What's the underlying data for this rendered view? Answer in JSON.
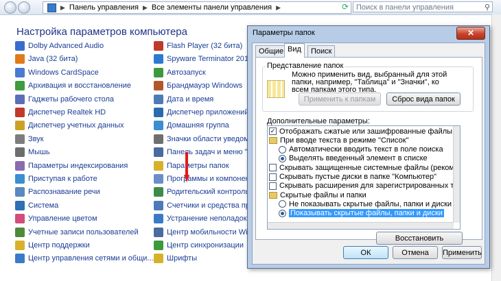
{
  "breadcrumbs": [
    "Панель управления",
    "Все элементы панели управления"
  ],
  "search_placeholder": "Поиск в панели управления",
  "page_title": "Настройка параметров компьютера",
  "left_items": [
    {
      "label": "Dolby Advanced Audio",
      "color": "#3b6ccd"
    },
    {
      "label": "Java (32 бита)",
      "color": "#e07b1a"
    },
    {
      "label": "Windows CardSpace",
      "color": "#4a7bd0"
    },
    {
      "label": "Архивация и восстановление",
      "color": "#3e9b3e"
    },
    {
      "label": "Гаджеты рабочего стола",
      "color": "#5b6fb8"
    },
    {
      "label": "Диспетчер Realtek HD",
      "color": "#c0392b"
    },
    {
      "label": "Диспетчер учетных данных",
      "color": "#c9a227"
    },
    {
      "label": "Звук",
      "color": "#7d7d7d"
    },
    {
      "label": "Мышь",
      "color": "#6d6d6d"
    },
    {
      "label": "Параметры индексирования",
      "color": "#8a6bb0"
    },
    {
      "label": "Приступая к работе",
      "color": "#3b8ed0"
    },
    {
      "label": "Распознавание речи",
      "color": "#5a88c0"
    },
    {
      "label": "Система",
      "color": "#2f6fb4"
    },
    {
      "label": "Управление цветом",
      "color": "#d24d7a"
    },
    {
      "label": "Учетные записи пользователей",
      "color": "#4f8a3c"
    },
    {
      "label": "Центр поддержки",
      "color": "#d8b12a"
    },
    {
      "label": "Центр управления сетями и общи...",
      "color": "#3a7bc8"
    }
  ],
  "right_items": [
    {
      "label": "Flash Player (32 бита)",
      "color": "#c0392b"
    },
    {
      "label": "Spyware Terminator 2015",
      "color": "#2d7bd1"
    },
    {
      "label": "Автозапуск",
      "color": "#3c9a3c"
    },
    {
      "label": "Брандмауэр Windows",
      "color": "#b3572a"
    },
    {
      "label": "Дата и время",
      "color": "#4f7ab8"
    },
    {
      "label": "Диспетчер приложений Int",
      "color": "#2a6bb0"
    },
    {
      "label": "Домашняя группа",
      "color": "#3b8ed0"
    },
    {
      "label": "Значки области уведомл",
      "color": "#6f6f6f"
    },
    {
      "label": "Панель задач и меню \"Пу",
      "color": "#4a6aa0"
    },
    {
      "label": "Параметры папок",
      "color": "#d8b12a"
    },
    {
      "label": "Программы и компоненты",
      "color": "#6a8fc8"
    },
    {
      "label": "Родительский контроль",
      "color": "#3e8a4a"
    },
    {
      "label": "Счетчики и средства про",
      "color": "#4f7ab8"
    },
    {
      "label": "Устранение неполадок",
      "color": "#3a7bc8"
    },
    {
      "label": "Центр мобильности Wind",
      "color": "#4a6aa0"
    },
    {
      "label": "Центр синхронизации",
      "color": "#3c9a3c"
    },
    {
      "label": "Шрифты",
      "color": "#d8b12a"
    }
  ],
  "dialog": {
    "title": "Параметры папок",
    "close_glyph": "✕",
    "tabs": [
      "Общие",
      "Вид",
      "Поиск"
    ],
    "active_tab": "Вид",
    "group_title": "Представление папок",
    "group_text": "Можно применить вид, выбранный для этой папки, например, \"Таблица\" и \"Значки\", ко всем папкам этого типа.",
    "apply_to_folders": "Применить к папкам",
    "reset_folders": "Сброс вида папок",
    "advanced_title": "Дополнительные параметры:",
    "advanced_items": [
      {
        "kind": "checkbox",
        "checked": true,
        "indent": 1,
        "label": "Отображать сжатые или зашифрованные файлы NTF"
      },
      {
        "kind": "folder",
        "indent": 1,
        "label": "При вводе текста в режиме \"Список\""
      },
      {
        "kind": "radio",
        "checked": false,
        "indent": 2,
        "label": "Автоматически вводить текст в поле поиска"
      },
      {
        "kind": "radio",
        "checked": true,
        "indent": 2,
        "label": "Выделять введенный элемент в списке"
      },
      {
        "kind": "checkbox",
        "checked": false,
        "indent": 1,
        "label": "Скрывать защищенные системные файлы (рекомен"
      },
      {
        "kind": "checkbox",
        "checked": false,
        "indent": 1,
        "label": "Скрывать пустые диски в папке \"Компьютер\""
      },
      {
        "kind": "checkbox",
        "checked": false,
        "indent": 1,
        "label": "Скрывать расширения для зарегистрированных типо"
      },
      {
        "kind": "folder",
        "indent": 1,
        "label": "Скрытые файлы и папки"
      },
      {
        "kind": "radio",
        "checked": false,
        "indent": 2,
        "label": "Не показывать скрытые файлы, папки и диски"
      },
      {
        "kind": "radio",
        "checked": true,
        "indent": 2,
        "selected": true,
        "label": "Показывать скрытые файлы, папки и диски"
      }
    ],
    "restore_defaults": "Восстановить умолчания",
    "ok": "ОК",
    "cancel": "Отмена",
    "apply": "Применить"
  }
}
